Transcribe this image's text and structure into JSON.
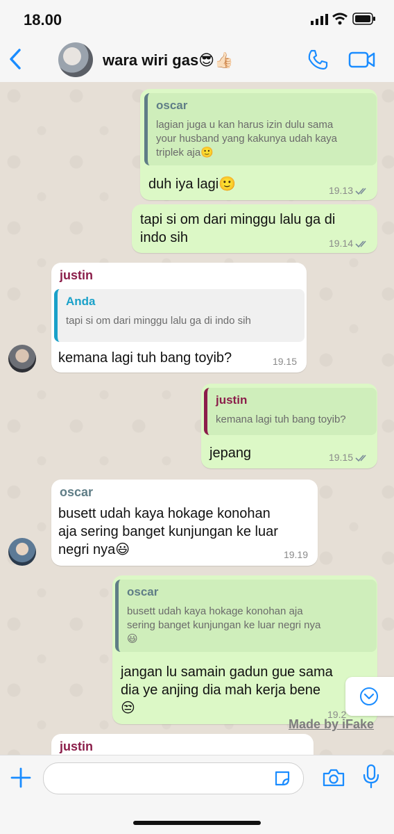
{
  "status_bar": {
    "time": "18.00"
  },
  "header": {
    "group_name": "wara wiri gas😎👍🏻"
  },
  "colors": {
    "sent_bubble": "#dcf8c6",
    "received_bubble": "#ffffff",
    "accent": "#1a8cff",
    "oscar": "#5f7d86",
    "justin": "#8b1e4a",
    "anda": "#1aa1c9"
  },
  "messages": [
    {
      "direction": "out",
      "reply_to": {
        "name": "oscar",
        "text": [
          "lagian juga u kan harus izin dulu sama",
          "your husband yang kakunya udah kaya",
          "triplek aja🙂"
        ]
      },
      "text": [
        "duh iya lagi🙂"
      ],
      "time": "19.13"
    },
    {
      "direction": "out",
      "text": [
        "tapi si om dari minggu lalu ga di",
        "indo sih"
      ],
      "time": "19.14"
    },
    {
      "direction": "in",
      "sender": "justin",
      "reply_to": {
        "name": "Anda",
        "text": [
          "tapi si om dari minggu lalu ga di indo sih"
        ]
      },
      "text": [
        "kemana lagi tuh bang toyib?"
      ],
      "time": "19.15"
    },
    {
      "direction": "out",
      "reply_to": {
        "name": "justin",
        "text": [
          "kemana lagi tuh bang toyib?"
        ]
      },
      "text": [
        "jepang"
      ],
      "time": "19.15"
    },
    {
      "direction": "in",
      "sender": "oscar",
      "text": [
        "busett udah kaya hokage konohan",
        "aja sering banget kunjungan ke luar",
        "negri nya😃"
      ],
      "time": "19.19"
    },
    {
      "direction": "out",
      "reply_to": {
        "name": "oscar",
        "text": [
          "busett udah kaya hokage konohan aja",
          "sering banget kunjungan ke luar negri nya",
          "😃"
        ]
      },
      "text": [
        "jangan lu samain gadun gue sama",
        "dia ye anjing dia mah kerja bene",
        "😒"
      ],
      "time": "19.2"
    },
    {
      "direction": "in",
      "sender": "justin"
    }
  ],
  "watermark": "Made by iFake",
  "icons": [
    "back-chevron-icon",
    "phone-icon",
    "video-icon",
    "plus-icon",
    "sticker-icon",
    "camera-icon",
    "mic-icon",
    "scroll-down-icon"
  ]
}
